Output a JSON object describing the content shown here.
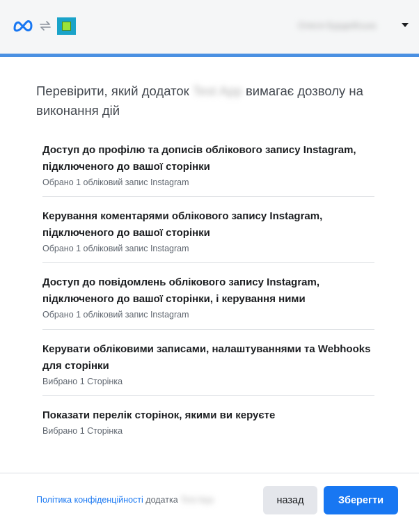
{
  "header": {
    "meta_logo_icon": "meta-logo-icon",
    "swap_icon": "swap-arrows-icon",
    "app_icon": "app-icon",
    "account_name": "Олеся Бурдейська",
    "account_menu_icon": "caret-down-icon"
  },
  "dialog": {
    "title_before": "Перевірити, який додаток ",
    "app_name": "Test App",
    "title_after": " вимагає дозволу на виконання дій",
    "permissions": [
      {
        "title": "Доступ до профілю та дописів облікового запису Instagram, підключеного до вашої сторінки",
        "subtitle": "Обрано 1 обліковий запис Instagram"
      },
      {
        "title": "Керування коментарями облікового запису Instagram, підключеного до вашої сторінки",
        "subtitle": "Обрано 1 обліковий запис Instagram"
      },
      {
        "title": "Доступ до повідомлень облікового запису Instagram, підключеного до вашої сторінки, і керування ними",
        "subtitle": "Обрано 1 обліковий запис Instagram"
      },
      {
        "title": "Керувати обліковими записами, налаштуваннями та Webhooks для сторінки",
        "subtitle": "Вибрано 1 Сторінка"
      },
      {
        "title": "Показати перелік сторінок, якими ви керуєте",
        "subtitle": "Вибрано 1 Сторінка"
      }
    ]
  },
  "footer": {
    "policy_link": "Політика конфіденційності",
    "policy_suffix": " додатка ",
    "app_name": "Test App",
    "back_label": "назад",
    "save_label": "Зберегти"
  },
  "colors": {
    "accent": "#1877f2",
    "header_strip": "#4a90e2",
    "header_bg": "#f5f6f7",
    "secondary_button": "#e4e6eb"
  }
}
